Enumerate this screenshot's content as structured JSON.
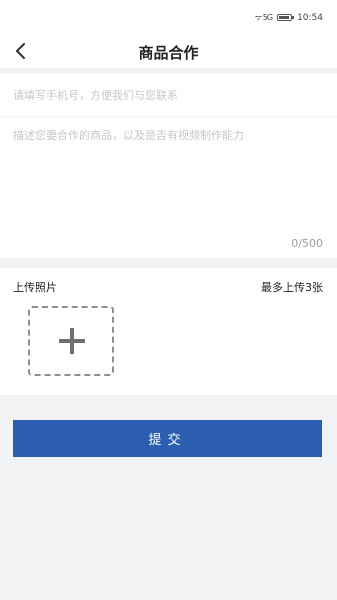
{
  "status_bar": {
    "signal": "ᯤ 5G",
    "time": "10:54"
  },
  "header": {
    "title": "商品合作",
    "back_icon": "chevron-left-icon"
  },
  "form": {
    "phone_placeholder": "请填写手机号，方便我们与您联系",
    "phone_value": "",
    "desc_placeholder": "描述您要合作的商品，以及是否有视频制作能力",
    "desc_value": "",
    "char_count": "0/500"
  },
  "photos": {
    "label": "上传照片",
    "limit": "最多上传3张",
    "add_icon": "plus-icon"
  },
  "actions": {
    "submit_label": "提交"
  },
  "colors": {
    "accent": "#2d5fb0",
    "background": "#f1f2f4"
  }
}
